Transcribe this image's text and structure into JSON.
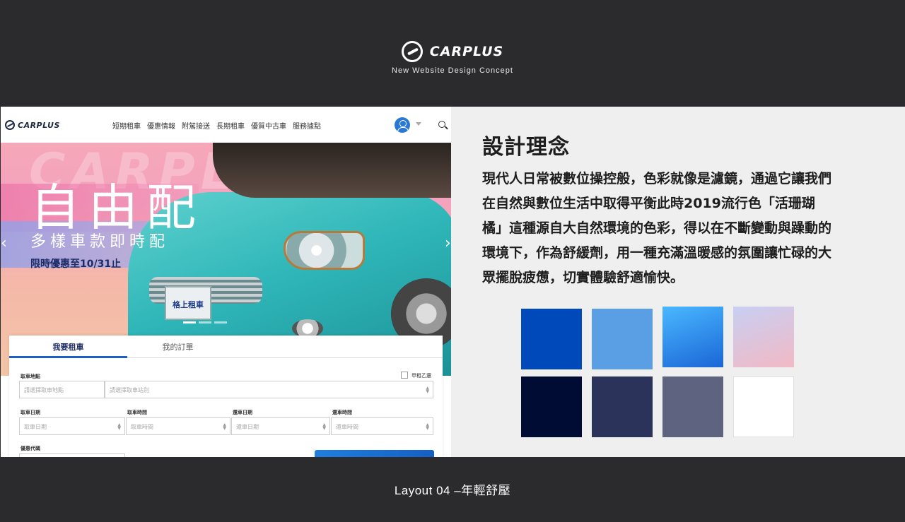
{
  "header": {
    "brand": "CARPLUS",
    "subtitle": "New Website Design Concept"
  },
  "site": {
    "logo": "CARPLUS",
    "menu": [
      "短期租車",
      "優惠情報",
      "附駕接送",
      "長期租車",
      "優質中古車",
      "服務據點"
    ],
    "hero": {
      "title": "自由配",
      "subtitle": "多樣車款即時配",
      "promo": "限時優惠至10/31止",
      "plate_text": "格上租車",
      "ghost_text": "CARPLUS"
    },
    "booking": {
      "tabs": [
        "我要租車",
        "我的訂單"
      ],
      "pickup_location_label": "取車地點",
      "pickup_location_placeholder": "請選擇取車地點",
      "pickup_station_placeholder": "請選擇取車站別",
      "diff_return_label": "甲租乙還",
      "pickup_date_label": "取車日期",
      "pickup_date_placeholder": "取車日期",
      "pickup_time_label": "取車時間",
      "pickup_time_placeholder": "取車時間",
      "return_date_label": "還車日期",
      "return_date_placeholder": "還車日期",
      "return_time_label": "還車時間",
      "return_time_placeholder": "還車時間",
      "promo_code_label": "優惠代碼"
    }
  },
  "concept": {
    "title": "設計理念",
    "lines": [
      "現代人日常被數位操控般，色彩就像是濾鏡，通過它讓我們",
      "在自然與數位生活中取得平衡此時2019流行色「活珊瑚",
      "橘」這種源自大自然環境的色彩，得以在不斷變動與躁動的",
      "環境下，作為舒緩劑，用一種充滿溫暖感的氛圍讓忙碌的大",
      "眾擺脫疲憊，切實體驗舒適愉快。"
    ]
  },
  "palette": {
    "colors": [
      "#0049bb",
      "#5a9ee3",
      "#4ab8ff",
      "#c8cff3",
      "#000c33",
      "#2b335a",
      "#5e6480",
      "#ffffff"
    ]
  },
  "footer": {
    "label": "Layout 04 –年輕舒壓"
  }
}
